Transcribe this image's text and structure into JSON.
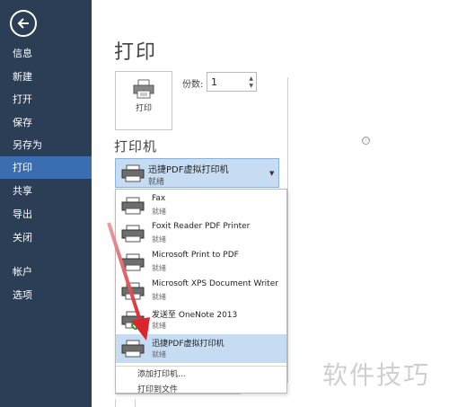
{
  "sidebar": {
    "back_icon": "back-arrow-icon",
    "items": [
      {
        "label": "信息"
      },
      {
        "label": "新建"
      },
      {
        "label": "打开"
      },
      {
        "label": "保存"
      },
      {
        "label": "另存为"
      },
      {
        "label": "打印",
        "active": true
      },
      {
        "label": "共享"
      },
      {
        "label": "导出"
      },
      {
        "label": "关闭"
      },
      {
        "label": "帐户"
      },
      {
        "label": "选项"
      }
    ]
  },
  "main": {
    "title": "打印",
    "print_button_label": "打印",
    "copies_label": "份数:",
    "copies_value": "1",
    "printer_section_title": "打印机",
    "info_icon": "ⓘ",
    "selected_printer": {
      "name": "迅捷PDF虚拟打印机",
      "status": "就绪"
    },
    "printers": [
      {
        "name": "Fax",
        "status": "就绪"
      },
      {
        "name": "Foxit Reader PDF Printer",
        "status": "就绪"
      },
      {
        "name": "Microsoft Print to PDF",
        "status": "就绪"
      },
      {
        "name": "Microsoft XPS Document Writer",
        "status": "就绪"
      },
      {
        "name": "发送至 OneNote 2013",
        "status": "就绪"
      },
      {
        "name": "迅捷PDF虚拟打印机",
        "status": "就绪"
      }
    ],
    "add_printer_label": "添加打印机...",
    "print_to_file_label": "打印到文件"
  },
  "watermark": "软件技巧",
  "colors": {
    "sidebar_bg": "#2b3e56",
    "active_bg": "#3b6eb1",
    "selected_bg": "#c6dcf3",
    "arrow": "#d9262c"
  }
}
